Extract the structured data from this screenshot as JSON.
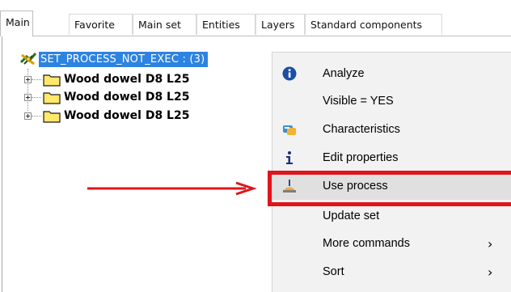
{
  "tabs": [
    "Main",
    "Favorite",
    "Main set",
    "Entities",
    "Layers",
    "Standard components"
  ],
  "active_tab": "Main",
  "tree": {
    "root_label": "SET_PROCESS_NOT_EXEC : (3)",
    "root_icon": "process-set-icon",
    "children": [
      {
        "label": "Wood dowel D8 L25",
        "icon": "folder-icon"
      },
      {
        "label": "Wood dowel D8 L25",
        "icon": "folder-icon"
      },
      {
        "label": "Wood dowel D8 L25",
        "icon": "folder-icon"
      }
    ]
  },
  "context_menu": {
    "items": [
      {
        "label": "Analyze",
        "icon": "info-circle-icon"
      },
      {
        "label": "Visible = YES",
        "icon": ""
      },
      {
        "label": "Characteristics",
        "icon": "characteristics-icon"
      },
      {
        "label": "Edit properties",
        "icon": "info-icon"
      },
      {
        "label": "Use process",
        "icon": "use-process-icon",
        "highlighted": true
      },
      {
        "label": "Update set",
        "icon": ""
      },
      {
        "label": "More commands",
        "icon": "",
        "submenu": true
      },
      {
        "label": "Sort",
        "icon": "",
        "submenu": true
      }
    ],
    "submenu_glyph": "›"
  },
  "colors": {
    "selection": "#2d83e0",
    "annotation_red": "#e0141b",
    "menu_background": "#f2f2f2",
    "folder_yellow": "#ffe86b"
  }
}
